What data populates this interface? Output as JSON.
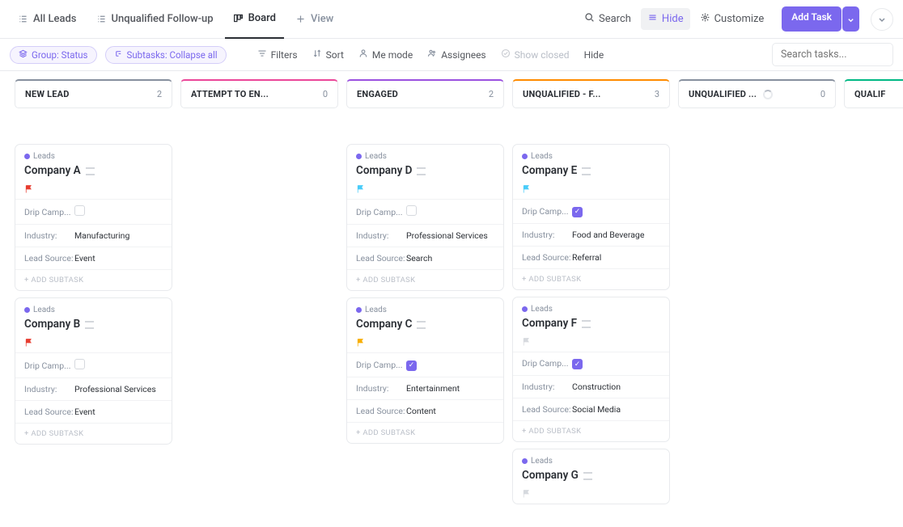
{
  "tabs": {
    "all_leads": "All Leads",
    "unqualified": "Unqualified Follow-up",
    "board": "Board",
    "view": "View"
  },
  "topbar": {
    "search": "Search",
    "hide": "Hide",
    "customize": "Customize",
    "add_task": "Add Task"
  },
  "filters": {
    "group": "Group: Status",
    "subtasks": "Subtasks: Collapse all",
    "filters": "Filters",
    "sort": "Sort",
    "me": "Me mode",
    "assignees": "Assignees",
    "show_closed": "Show closed",
    "hide": "Hide",
    "search_placeholder": "Search tasks..."
  },
  "labels": {
    "leads": "Leads",
    "drip": "Drip Camp...",
    "industry": "Industry:",
    "source": "Lead Source:",
    "add_subtask": "+ ADD SUBTASK"
  },
  "columns": [
    {
      "name": "NEW LEAD",
      "count": "2",
      "color": "#87909e",
      "cards": [
        {
          "title": "Company A",
          "flag": "#e73d30",
          "drip": false,
          "industry": "Manufacturing",
          "source": "Event"
        },
        {
          "title": "Company B",
          "flag": "#e73d30",
          "drip": false,
          "industry": "Professional Services",
          "source": "Event"
        }
      ]
    },
    {
      "name": "ATTEMPT TO EN...",
      "count": "0",
      "color": "#eb4799",
      "cards": []
    },
    {
      "name": "ENGAGED",
      "count": "2",
      "color": "#9b51e0",
      "cards": [
        {
          "title": "Company D",
          "flag": "#49ccf9",
          "drip": false,
          "industry": "Professional Services",
          "source": "Search"
        },
        {
          "title": "Company C",
          "flag": "#f8ae00",
          "drip": true,
          "industry": "Entertainment",
          "source": "Content"
        }
      ]
    },
    {
      "name": "UNQUALIFIED - F...",
      "count": "3",
      "color": "#ff8b00",
      "cards": [
        {
          "title": "Company E",
          "flag": "#49ccf9",
          "drip": true,
          "industry": "Food and Beverage",
          "source": "Referral"
        },
        {
          "title": "Company F",
          "flag": "#d6d9de",
          "drip": true,
          "industry": "Construction",
          "source": "Social Media"
        },
        {
          "title": "Company G",
          "flag": "#d6d9de",
          "drip": null,
          "industry": "",
          "source": "",
          "partial": true
        }
      ]
    },
    {
      "name": "UNQUALIFIED ...",
      "count": "0",
      "color": "#87909e",
      "loading": true,
      "cards": []
    },
    {
      "name": "QUALIF",
      "count": "",
      "color": "#00b884",
      "cards": []
    }
  ]
}
